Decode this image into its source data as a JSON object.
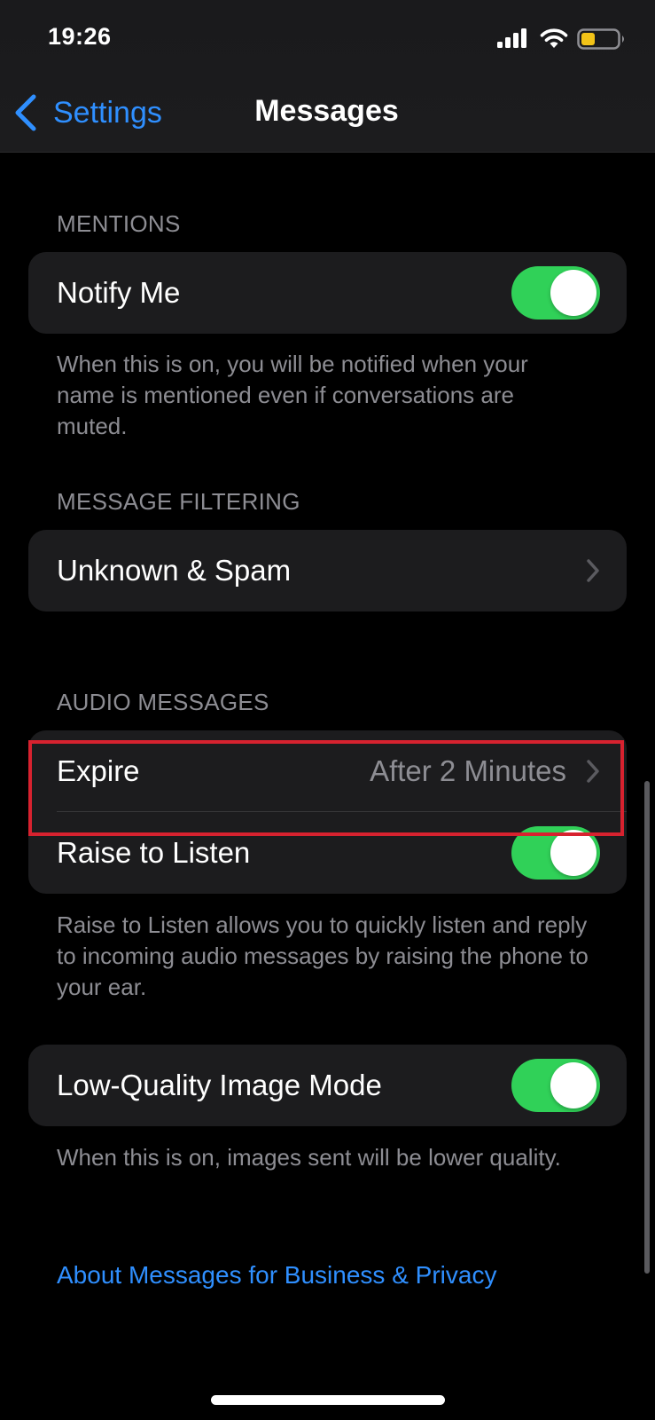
{
  "status_bar": {
    "time": "19:26",
    "icons": [
      "cellular-signal-icon",
      "wifi-icon",
      "battery-low-icon"
    ],
    "battery_color": "#f2c318"
  },
  "nav": {
    "back_label": "Settings",
    "title": "Messages"
  },
  "mentions": {
    "header": "MENTIONS",
    "notify_me": {
      "label": "Notify Me",
      "toggle_on": true
    },
    "footnote": "When this is on, you will be notified when your name is mentioned even if conversations are muted."
  },
  "message_filtering": {
    "header": "MESSAGE FILTERING",
    "unknown_spam": {
      "label": "Unknown & Spam"
    }
  },
  "audio_messages": {
    "header": "AUDIO MESSAGES",
    "expire": {
      "label": "Expire",
      "value": "After 2 Minutes"
    },
    "raise_to_listen": {
      "label": "Raise to Listen",
      "toggle_on": true
    },
    "footnote": "Raise to Listen allows you to quickly listen and reply to incoming audio messages by raising the phone to your ear."
  },
  "low_quality": {
    "label": "Low-Quality Image Mode",
    "toggle_on": true,
    "footnote": "When this is on, images sent will be lower quality."
  },
  "about_link": "About Messages for Business & Privacy",
  "colors": {
    "accent": "#2f8fff",
    "toggle_on": "#30d158",
    "highlight_box": "#d7222f",
    "cell_background": "#1c1c1e"
  }
}
